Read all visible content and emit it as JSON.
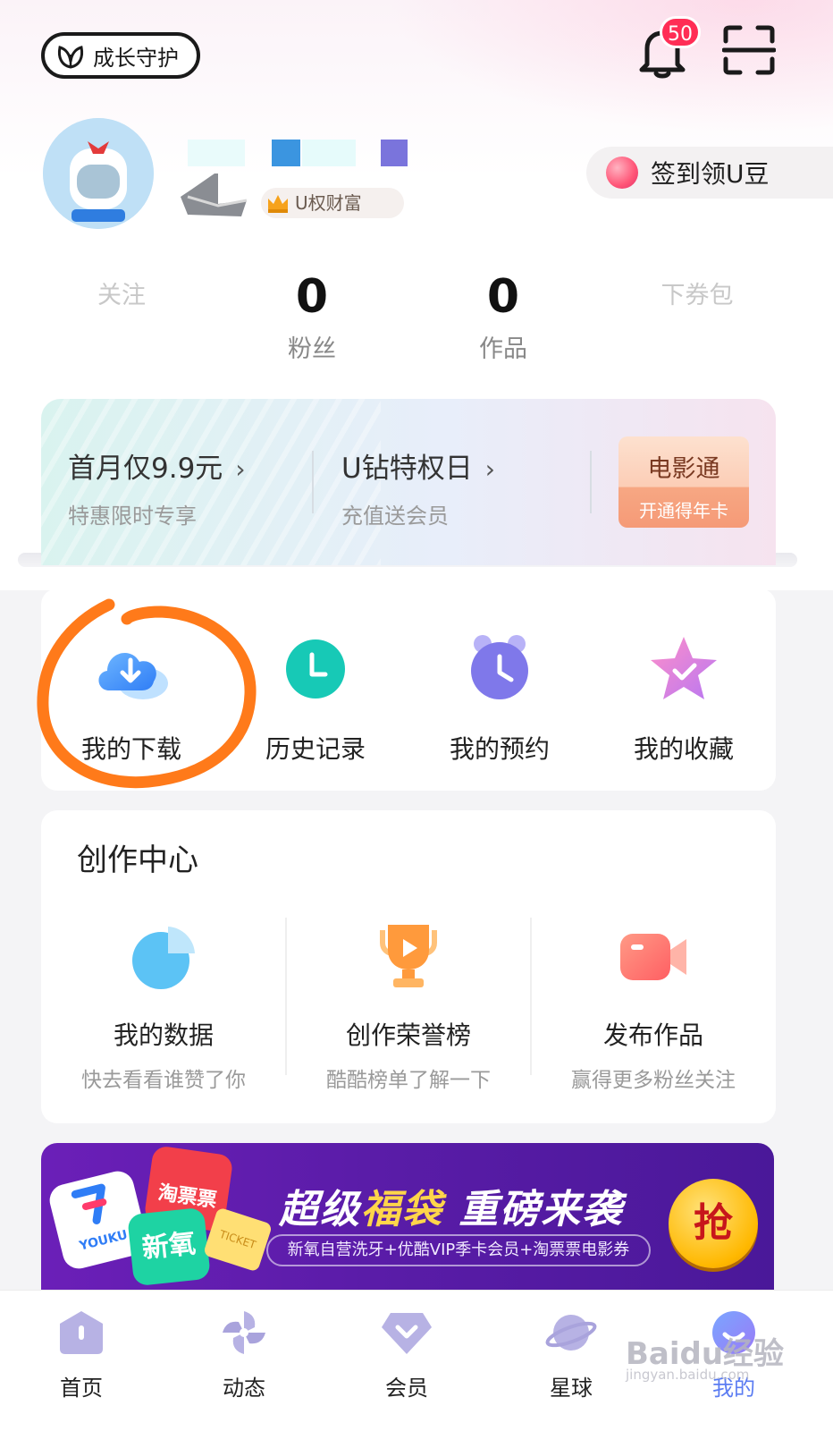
{
  "header": {
    "guardian_label": "成长守护",
    "notification_count": "50"
  },
  "profile": {
    "level_tag": "U权财富",
    "checkin_label": "签到领U豆"
  },
  "stats": [
    {
      "value": "",
      "label": "关注"
    },
    {
      "value": "0",
      "label": "粉丝"
    },
    {
      "value": "0",
      "label": "作品"
    },
    {
      "value": "",
      "label": "下券包"
    }
  ],
  "vip_banner": {
    "offer1_title": "首月仅9.9元",
    "offer1_sub": "特惠限时专享",
    "offer2_title": "U钻特权日",
    "offer2_sub": "充值送会员",
    "movie_title": "电影通",
    "movie_sub": "开通得年卡"
  },
  "quick_actions": [
    {
      "label": "我的下载",
      "icon": "download-cloud-icon"
    },
    {
      "label": "历史记录",
      "icon": "history-clock-icon"
    },
    {
      "label": "我的预约",
      "icon": "alarm-clock-icon"
    },
    {
      "label": "我的收藏",
      "icon": "favorite-star-icon"
    }
  ],
  "creation_center": {
    "title": "创作中心",
    "items": [
      {
        "title": "我的数据",
        "sub": "快去看看谁赞了你",
        "icon": "pie-chart-icon"
      },
      {
        "title": "创作荣誉榜",
        "sub": "酷酷榜单了解一下",
        "icon": "trophy-play-icon"
      },
      {
        "title": "发布作品",
        "sub": "赢得更多粉丝关注",
        "icon": "video-camera-icon"
      }
    ]
  },
  "promo": {
    "title_part1": "超级",
    "title_highlight": "福袋",
    "title_part2": " 重磅来袭",
    "subtitle": "新氧自营洗牙+优酷VIP季卡会员+淘票票电影券",
    "button_label": "抢",
    "tile_youku": "YOUKU",
    "tile_taopiao": "淘票票",
    "tile_xinyang": "新氧",
    "tile_ticket": "TICKET"
  },
  "bottom_nav": [
    {
      "label": "首页",
      "icon": "home-icon"
    },
    {
      "label": "动态",
      "icon": "pinwheel-icon"
    },
    {
      "label": "会员",
      "icon": "vip-diamond-icon"
    },
    {
      "label": "星球",
      "icon": "planet-icon"
    },
    {
      "label": "我的",
      "icon": "profile-icon",
      "active": true
    }
  ],
  "watermark": {
    "text": "Baidu经验",
    "url": "jingyan.baidu.com"
  },
  "colors": {
    "accent_orange": "#ff7a1a",
    "badge_red": "#ff2d55",
    "active_nav": "#5b7cf2"
  }
}
